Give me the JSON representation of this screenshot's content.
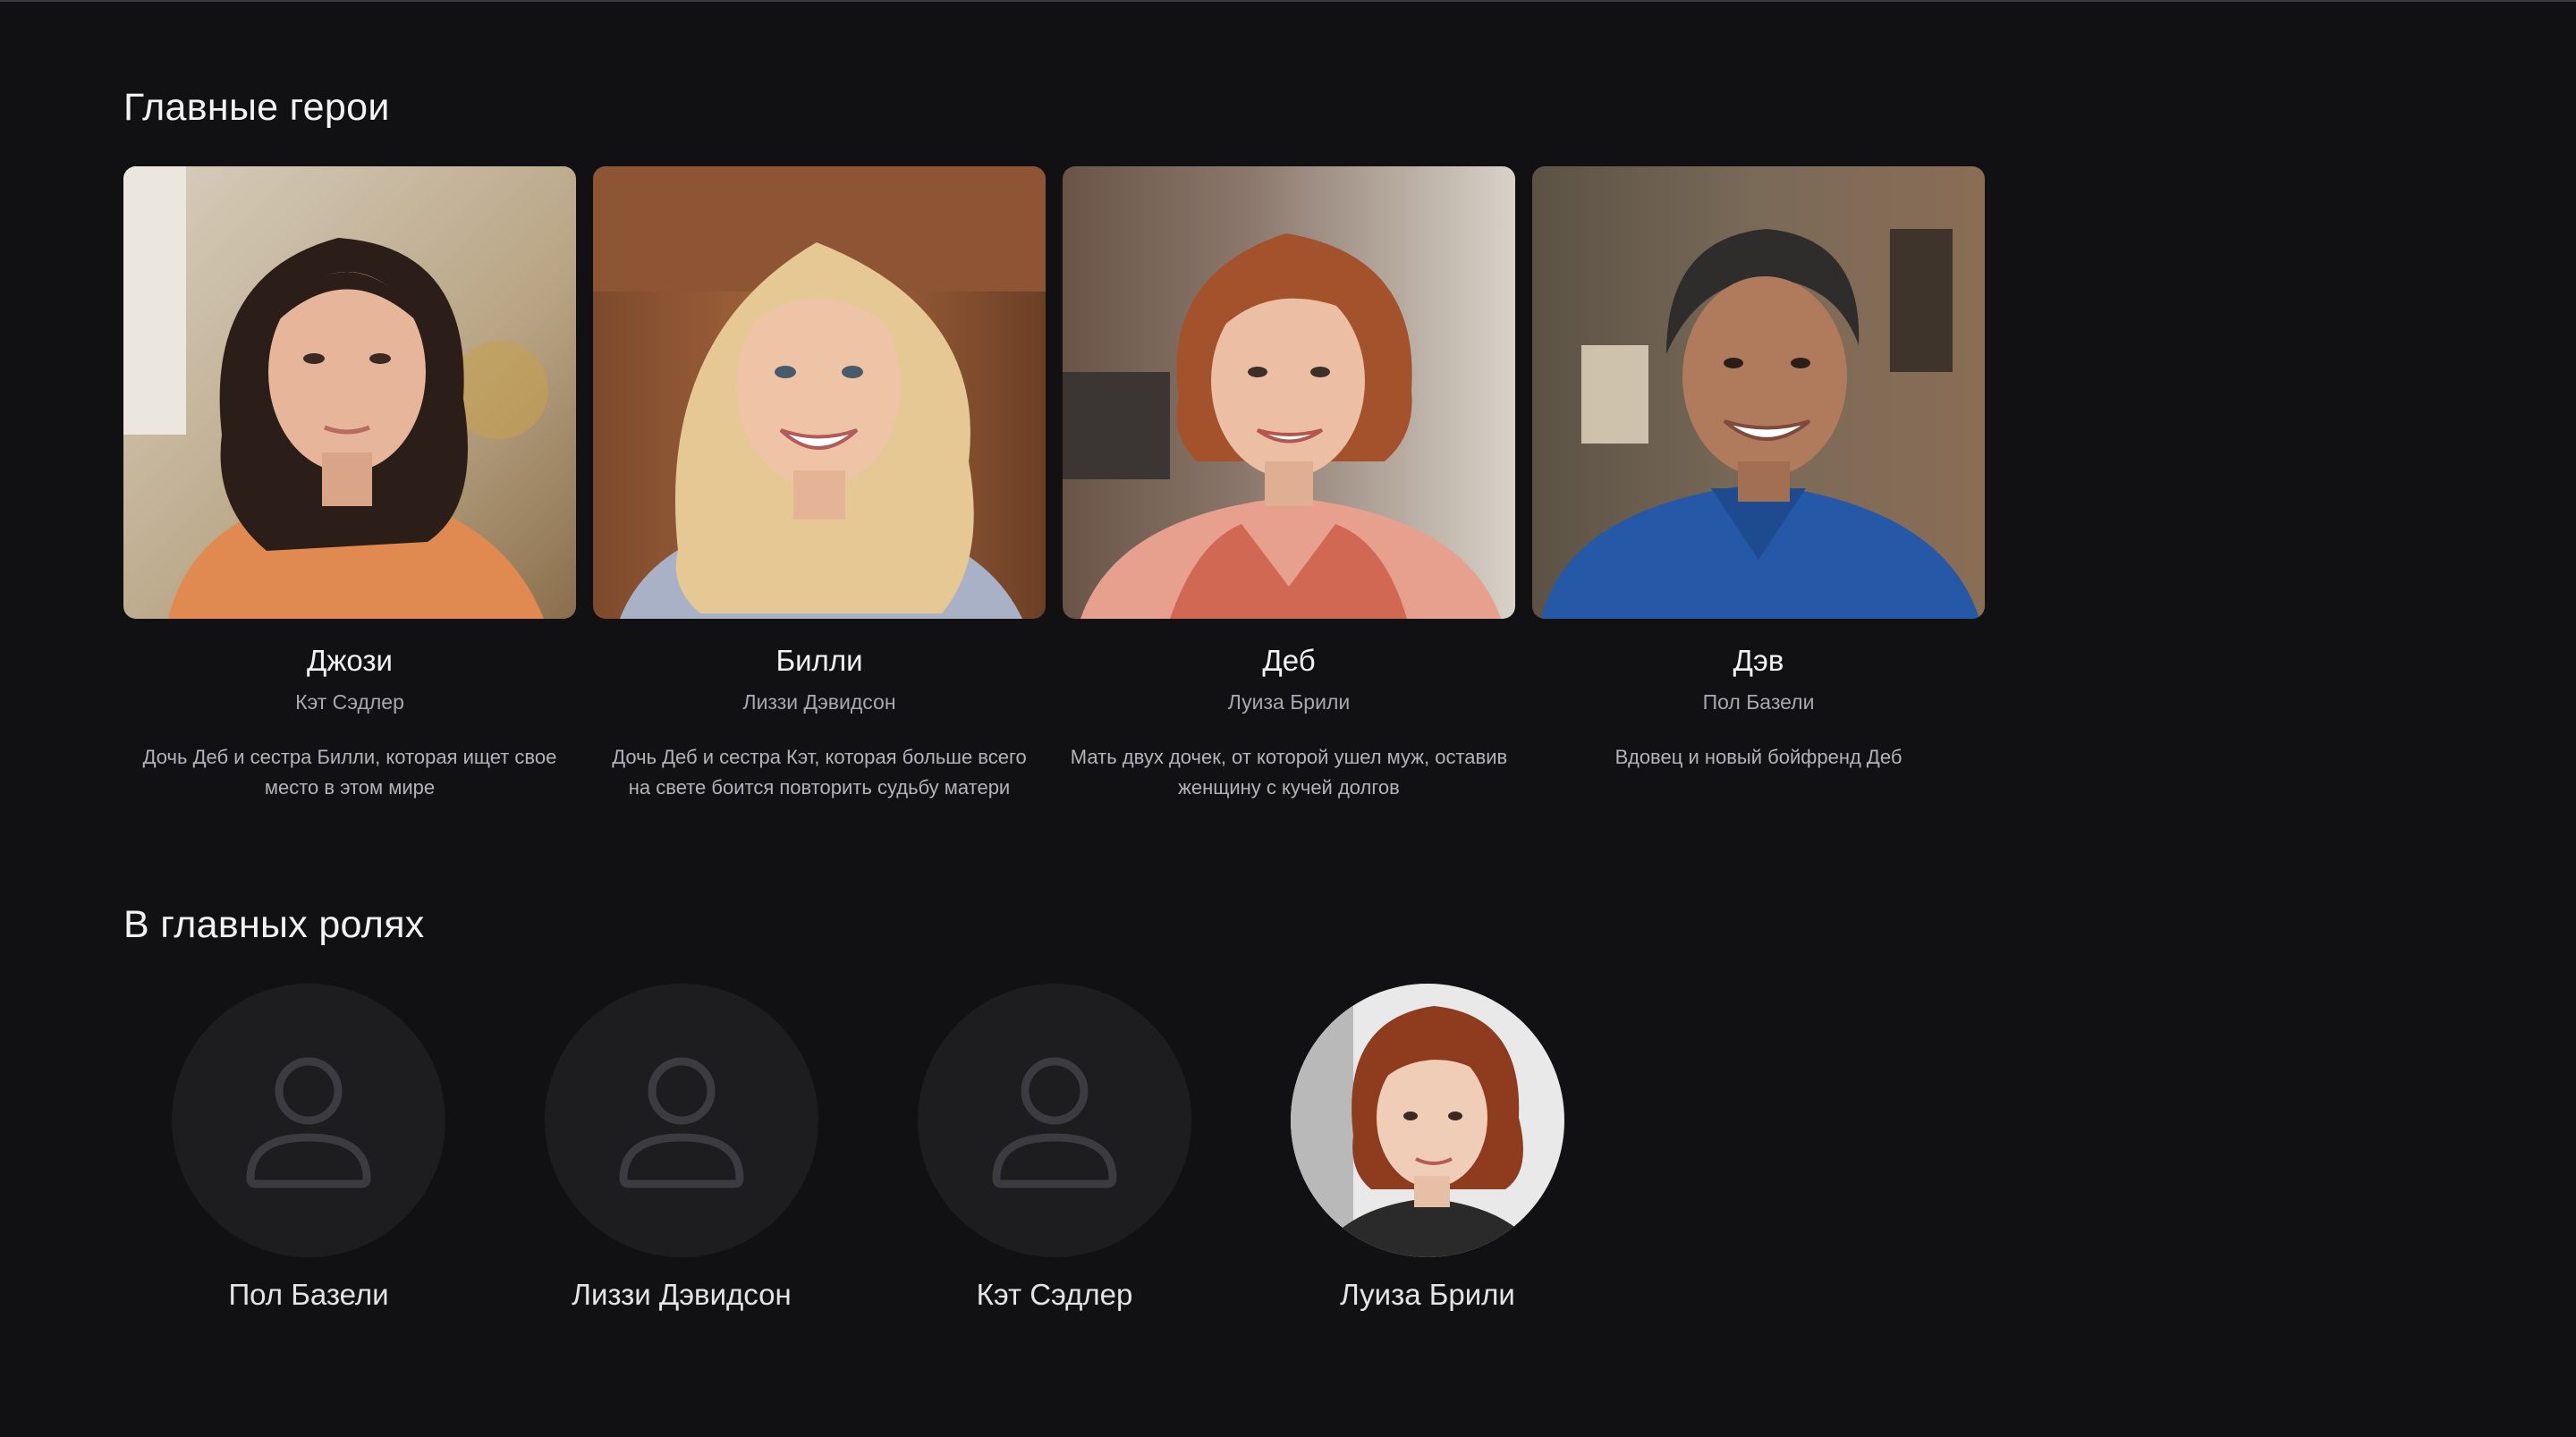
{
  "sections": {
    "heroes_title": "Главные герои",
    "cast_title": "В главных ролях"
  },
  "heroes": [
    {
      "name": "Джози",
      "actor": "Кэт Сэдлер",
      "description": "Дочь Деб и сестра Билли, которая ищет свое место в этом мире"
    },
    {
      "name": "Билли",
      "actor": "Лиззи Дэвидсон",
      "description": "Дочь Деб и сестра Кэт, которая больше всего на свете боится повторить судьбу матери"
    },
    {
      "name": "Деб",
      "actor": "Луиза Брили",
      "description": "Мать двух дочек, от которой ушел муж, оставив женщину с кучей долгов"
    },
    {
      "name": "Дэв",
      "actor": "Пол Базели",
      "description": "Вдовец и новый бойфренд Деб"
    }
  ],
  "cast": [
    {
      "name": "Пол Базели",
      "avatar": "placeholder-user-icon"
    },
    {
      "name": "Лиззи Дэвидсон",
      "avatar": "placeholder-user-icon"
    },
    {
      "name": "Кэт Сэдлер",
      "avatar": "placeholder-user-icon"
    },
    {
      "name": "Луиза Брили",
      "avatar": "photo"
    }
  ],
  "colors": {
    "background": "#111113",
    "placeholder_circle": "#1d1d20",
    "placeholder_icon": "#3b3b40"
  }
}
